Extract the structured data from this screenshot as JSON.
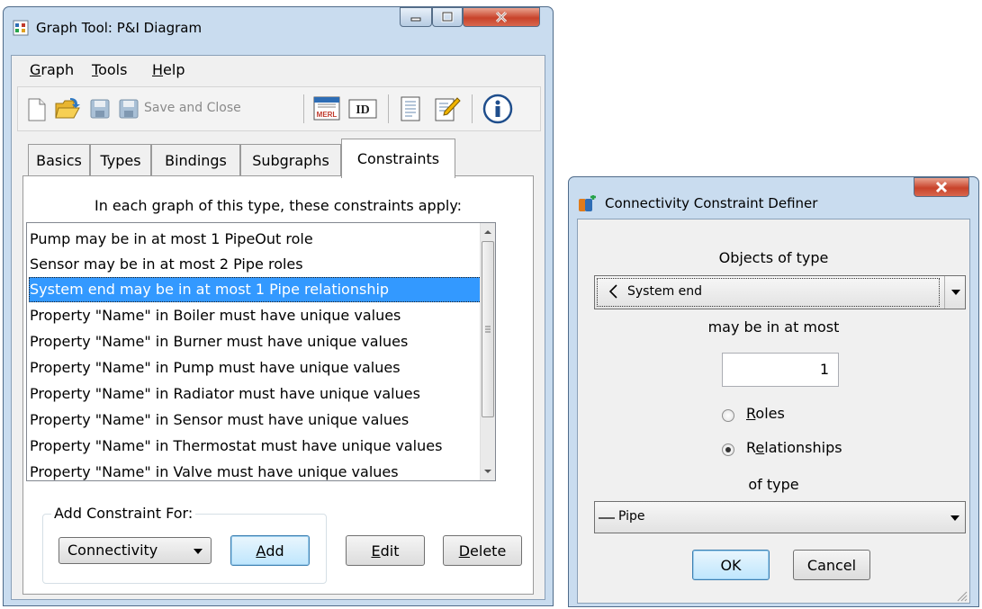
{
  "main_window": {
    "title": "Graph Tool: P&I Diagram",
    "menu": [
      {
        "label": "Graph",
        "mnemonic": "G",
        "rest": "raph"
      },
      {
        "label": "Tools",
        "mnemonic": "T",
        "rest": "ools"
      },
      {
        "label": "Help",
        "mnemonic": "H",
        "rest": "elp"
      }
    ],
    "toolbar": {
      "save_and_close_label": "Save and Close",
      "icons": [
        "new-icon",
        "open-icon",
        "save-icon",
        "save-and-close-icon",
        "merl-icon",
        "id-icon",
        "document-icon",
        "edit-icon",
        "info-icon"
      ],
      "merl_text": "MERL",
      "id_text": "ID"
    },
    "tabs": [
      "Basics",
      "Types",
      "Bindings",
      "Subgraphs",
      "Constraints"
    ],
    "active_tab": "Constraints",
    "constraints_heading": "In each graph of this type, these constraints apply:",
    "constraints": [
      "Pump may be in at most 1 PipeOut role",
      "Sensor may be in at most 2 Pipe roles",
      "System end may be in at most 1 Pipe relationship",
      "Property \"Name\" in Boiler must have unique values",
      "Property \"Name\" in Burner must have unique values",
      "Property \"Name\" in Pump must have unique values",
      "Property \"Name\" in Radiator must have unique values",
      "Property \"Name\" in Sensor must have unique values",
      "Property \"Name\" in Thermostat must have unique values",
      "Property \"Name\" in Valve must have unique values"
    ],
    "selected_constraint_index": 2,
    "add_group_label": "Add Constraint For:",
    "add_type_value": "Connectivity",
    "add_button": {
      "mnemonic": "A",
      "rest": "dd"
    },
    "edit_button": {
      "mnemonic": "E",
      "rest": "dit"
    },
    "delete_button": {
      "mnemonic": "D",
      "rest": "elete"
    }
  },
  "dialog": {
    "title": "Connectivity Constraint Definer",
    "objects_label": "Objects of type",
    "object_type_value": "System end",
    "may_be_label": "may be in at most",
    "count_value": "1",
    "roles_option": {
      "mnemonic": "R",
      "rest": "oles",
      "checked": false
    },
    "relationships_option": {
      "prefix": "R",
      "mnemonic": "e",
      "rest": "lationships",
      "checked": true
    },
    "of_type_label": "of type",
    "relationship_type_value": "Pipe",
    "ok_label": "OK",
    "cancel_label": "Cancel"
  },
  "colors": {
    "selection": "#3399ff",
    "frame": "#c9dcef",
    "close_button": "#c8432b"
  }
}
